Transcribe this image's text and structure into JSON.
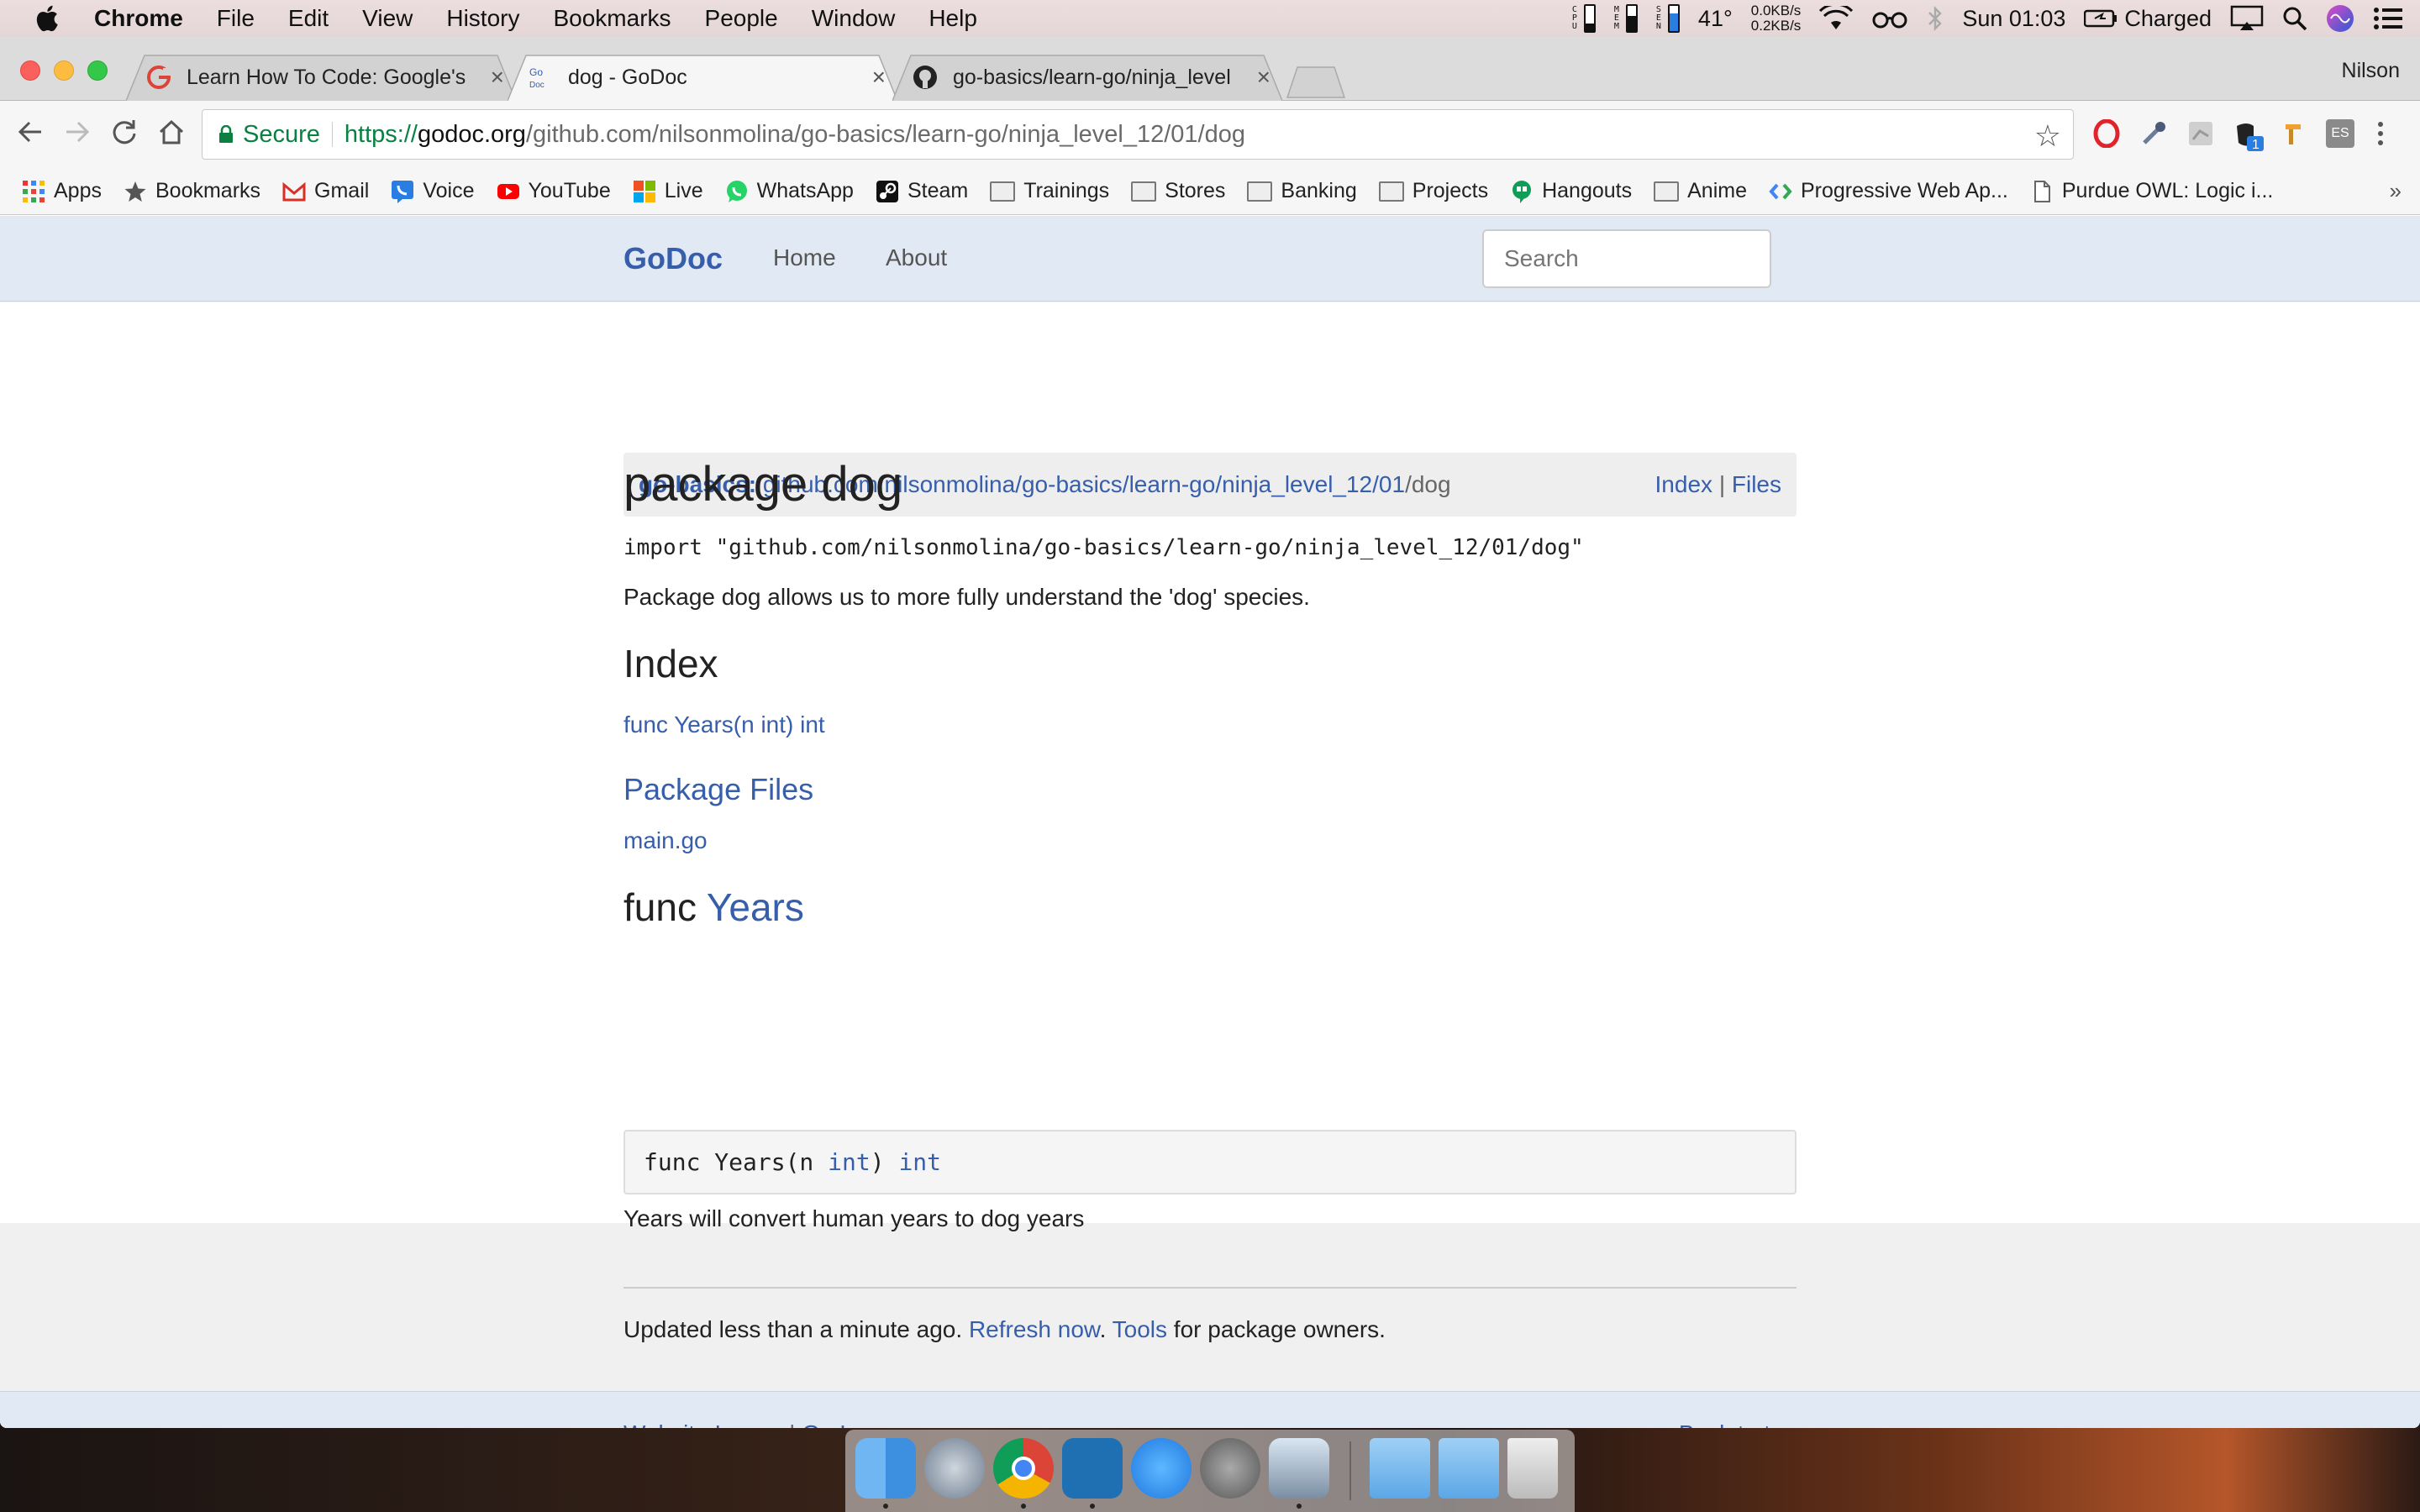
{
  "menubar": {
    "app": "Chrome",
    "items": [
      "File",
      "Edit",
      "View",
      "History",
      "Bookmarks",
      "People",
      "Window",
      "Help"
    ],
    "temp": "41°",
    "net_up": "0.0KB/s",
    "net_down": "0.2KB/s",
    "clock": "Sun 01:03",
    "battery": "Charged",
    "stat_labels": [
      "CPU",
      "MEM",
      "SEN"
    ]
  },
  "tabs": [
    {
      "title": "Learn How To Code: Google's Go",
      "icon": "google-icon"
    },
    {
      "title": "dog - GoDoc",
      "icon": "godoc-icon"
    },
    {
      "title": "go-basics/learn-go/ninja_level",
      "icon": "github-icon"
    }
  ],
  "profile": "Nilson",
  "omnibox": {
    "secure": "Secure",
    "scheme": "https://",
    "host": "godoc.org",
    "path": "/github.com/nilsonmolina/go-basics/learn-go/ninja_level_12/01/dog"
  },
  "bookmarks": {
    "items": [
      "Apps",
      "Bookmarks",
      "Gmail",
      "Voice",
      "YouTube",
      "Live",
      "WhatsApp",
      "Steam",
      "Trainings",
      "Stores",
      "Banking",
      "Projects",
      "Hangouts",
      "Anime",
      "Progressive Web Ap...",
      "Purdue OWL: Logic i..."
    ],
    "more": "»"
  },
  "godoc": {
    "brand": "GoDoc",
    "nav": [
      "Home",
      "About"
    ],
    "search_placeholder": "Search",
    "crumb_repo": "go-basics:",
    "crumb_path": "github.com/nilsonmolina/go-basics/learn-go/ninja_level_12/01",
    "crumb_leaf": "/dog",
    "crumb_index": "Index",
    "crumb_sep": "|",
    "crumb_files": "Files",
    "title": "package dog",
    "import_line": "import \"github.com/nilsonmolina/go-basics/learn-go/ninja_level_12/01/dog\"",
    "description": "Package dog allows us to more fully understand the 'dog' species.",
    "index_heading": "Index",
    "index_items": [
      "func Years(n int) int"
    ],
    "files_heading": "Package Files",
    "files": [
      "main.go"
    ],
    "func_keyword": "func",
    "func_name": "Years",
    "sig_prefix": "func Years(n ",
    "sig_type1": "int",
    "sig_mid": ") ",
    "sig_type2": "int",
    "func_doc": "Years will convert human years to dog years",
    "updated_text": "Updated less than a minute ago.",
    "refresh": "Refresh now",
    "dot": ".",
    "tools": "Tools",
    "tools_suffix": "for package owners."
  },
  "footer": {
    "issues": "Website Issues",
    "sep": "|",
    "golang": "Go Language",
    "top": "Back to top"
  },
  "dock": [
    "finder-icon",
    "launchpad-icon",
    "chrome-icon",
    "vscode-icon",
    "appstore-icon",
    "system-preferences-icon",
    "preview-icon",
    "applications-folder-icon",
    "downloads-folder-icon",
    "trash-icon"
  ]
}
